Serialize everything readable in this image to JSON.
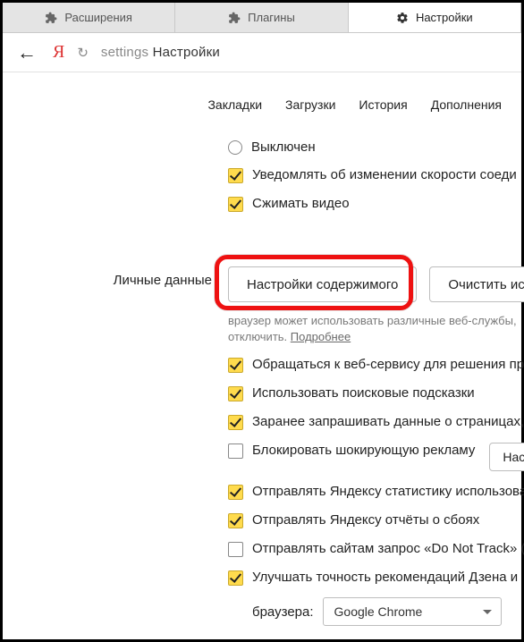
{
  "tabs": [
    {
      "label": "Расширения"
    },
    {
      "label": "Плагины"
    },
    {
      "label": "Настройки"
    }
  ],
  "toolbar": {
    "address_grey": "settings",
    "address_black": "Настройки"
  },
  "subnav": {
    "bookmarks": "Закладки",
    "downloads": "Загрузки",
    "history": "История",
    "addons": "Дополнения"
  },
  "top_opts": {
    "radio_off": "Выключен",
    "notify_speed": "Уведомлять об изменении скорости соеди",
    "compress_video": "Сжимать видео"
  },
  "personal": {
    "section_title": "Личные данные",
    "btn_content": "Настройки содержимого",
    "btn_clear": "Очистить исто",
    "hint_line": "враузер может использовать различные веб-службы,",
    "hint_off": "отключить.",
    "hint_more": "Подробнее",
    "opts": {
      "web_service": "Обращаться к веб-сервису для решения пр",
      "suggestions": "Использовать поисковые подсказки",
      "prefetch": "Заранее запрашивать данные о страницах,",
      "block_ads": "Блокировать шокирующую рекламу",
      "block_ads_btn": "Наст",
      "stats": "Отправлять Яндексу статистику использова",
      "crash": "Отправлять Яндексу отчёты о сбоях",
      "dnt": "Отправлять сайтам запрос «Do Not Track» (",
      "zen": "Улучшать точность рекомендаций Дзена и"
    },
    "browser_label": "браузера:",
    "browser_value": "Google Chrome"
  }
}
